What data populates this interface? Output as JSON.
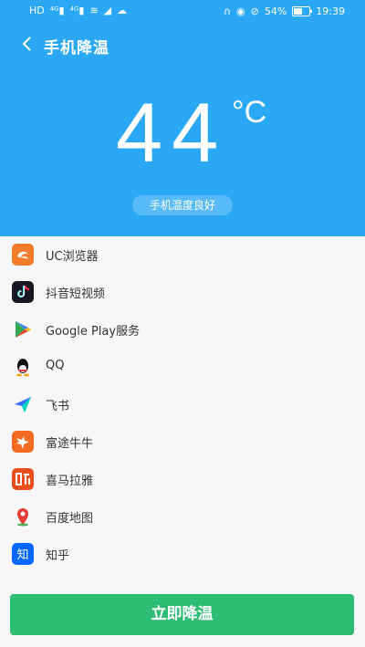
{
  "statusbar": {
    "left_icons": [
      "hd-icon",
      "signal-4g-icon",
      "signal-4g-icon",
      "wifi-icon",
      "signal-icon",
      "cloud-icon"
    ],
    "right_icons": [
      "headset-icon",
      "eye-icon",
      "mute-icon"
    ],
    "battery_percent": "54%",
    "battery_level": 0.54,
    "time": "19:39"
  },
  "header": {
    "title": "手机降温"
  },
  "temperature": {
    "value": "44",
    "unit": "°C",
    "status": "手机温度良好"
  },
  "apps": [
    {
      "name": "UC浏览器",
      "icon": "uc-browser-icon",
      "color": "#f37c2b"
    },
    {
      "name": "抖音短视频",
      "icon": "douyin-icon",
      "color": "#161823"
    },
    {
      "name": "Google Play服务",
      "icon": "google-play-icon",
      "color": "#34a853"
    },
    {
      "name": "QQ",
      "icon": "qq-icon",
      "color": "#000000"
    },
    {
      "name": "飞书",
      "icon": "feishu-icon",
      "color": "#3370ff"
    },
    {
      "name": "富途牛牛",
      "icon": "futu-icon",
      "color": "#f26b21"
    },
    {
      "name": "喜马拉雅",
      "icon": "ximalaya-icon",
      "color": "#e94e1b"
    },
    {
      "name": "百度地图",
      "icon": "baidu-map-icon",
      "color": "#e53935"
    },
    {
      "name": "知乎",
      "icon": "zhihu-icon",
      "color": "#0066ff"
    }
  ],
  "cta_label": "立即降温",
  "colors": {
    "header_bg": "#2aa8f5",
    "cta_bg": "#2dbd74",
    "page_bg": "#f7f7f7"
  }
}
